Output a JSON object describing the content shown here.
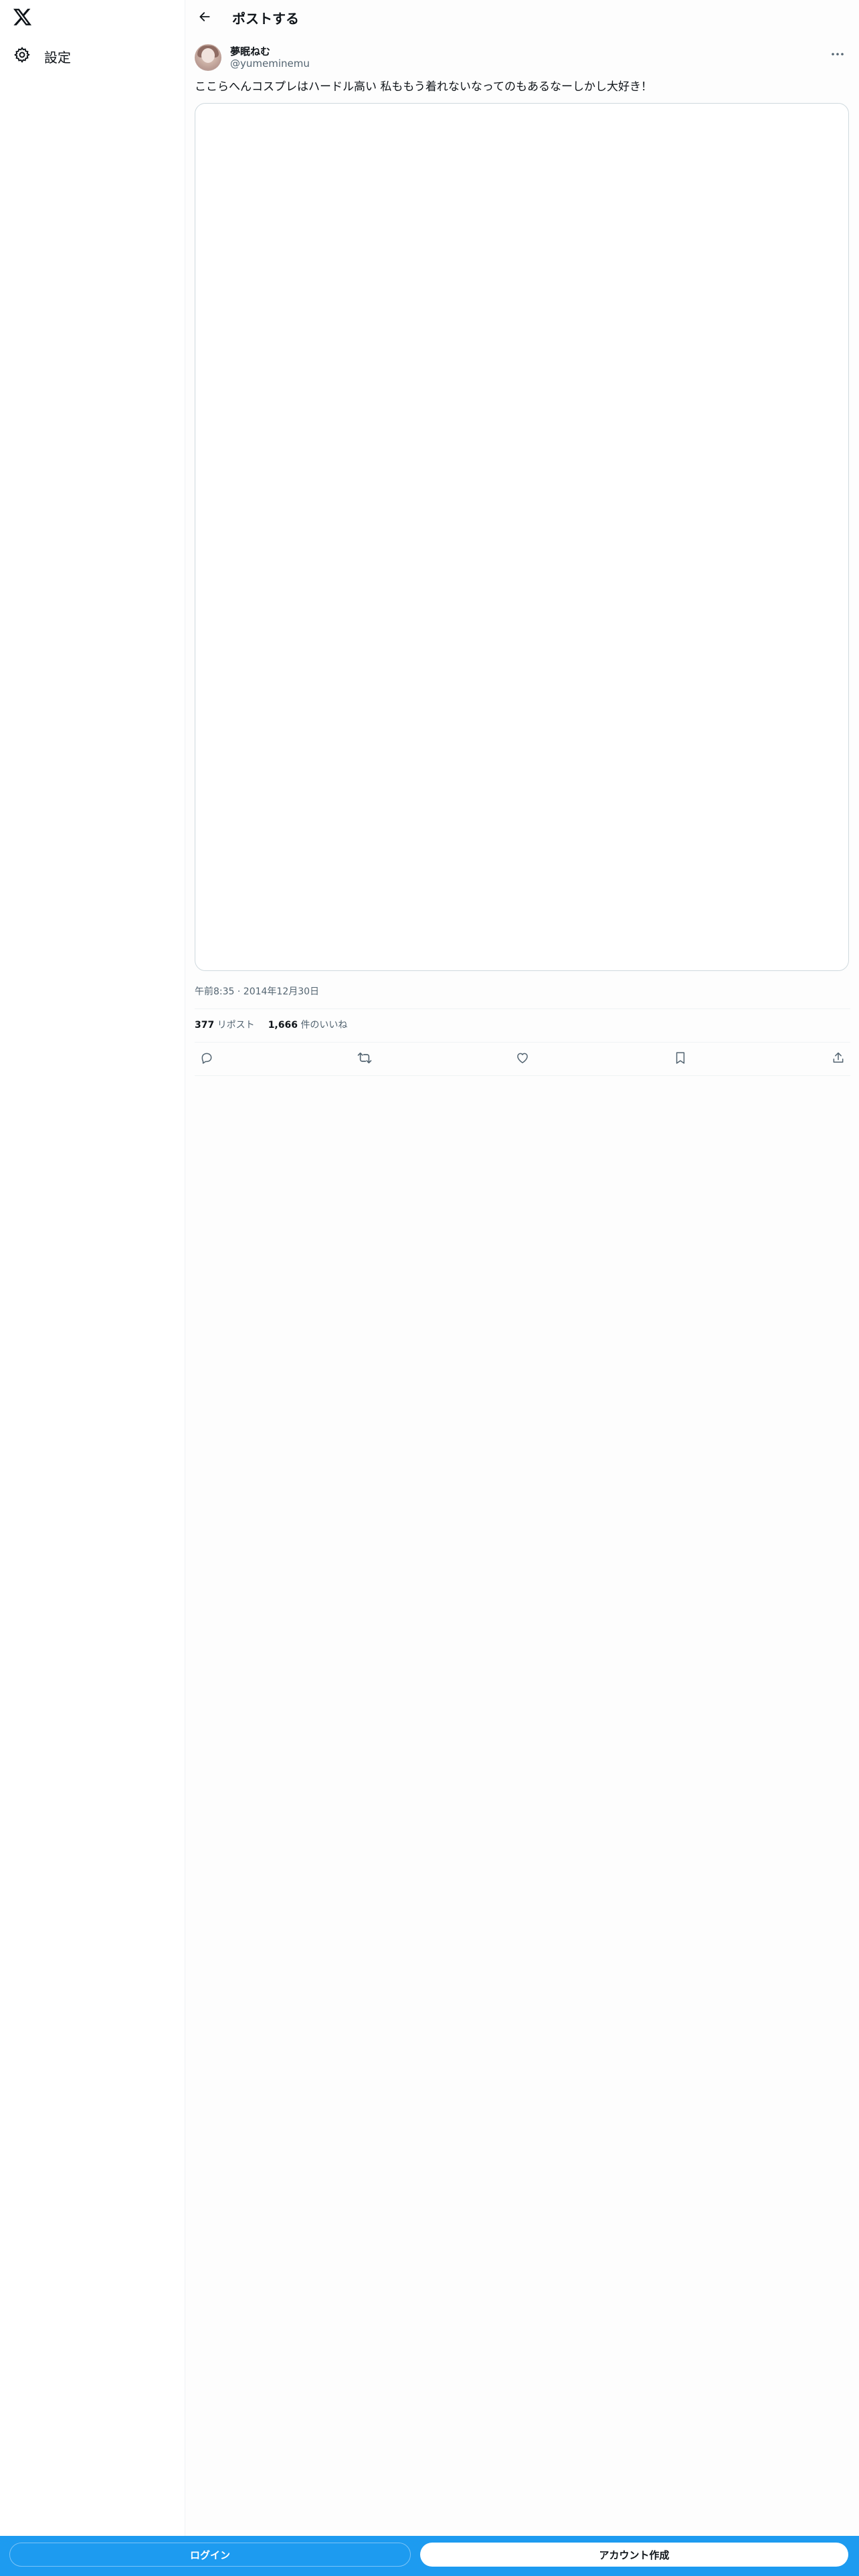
{
  "sidebar": {
    "logo_icon": "x-logo-icon",
    "items": [
      {
        "label": "設定",
        "icon": "gear-icon"
      }
    ]
  },
  "header": {
    "back_icon": "arrow-left-icon",
    "title": "ポストする"
  },
  "post": {
    "author_name": "夢眠ねむ",
    "author_handle": "@yumeminemu",
    "more_icon": "more-horizontal-icon",
    "text": "ここらへんコスプレはハードル高い 私ももう着れないなってのもあるなーしかし大好き！",
    "timestamp": "午前8:35 · 2014年12月30日",
    "stats": {
      "reposts_count": "377",
      "reposts_label": "リポスト",
      "likes_count": "1,666",
      "likes_label": "件のいいね"
    },
    "actions": [
      "reply-icon",
      "repost-icon",
      "like-icon",
      "bookmark-icon",
      "share-icon"
    ]
  },
  "bottom_bar": {
    "login_label": "ログイン",
    "signup_label": "アカウント作成"
  },
  "colors": {
    "accent": "#1d9bf0",
    "text_primary": "#0f1419",
    "text_secondary": "#536471",
    "border": "#cfd9de"
  }
}
